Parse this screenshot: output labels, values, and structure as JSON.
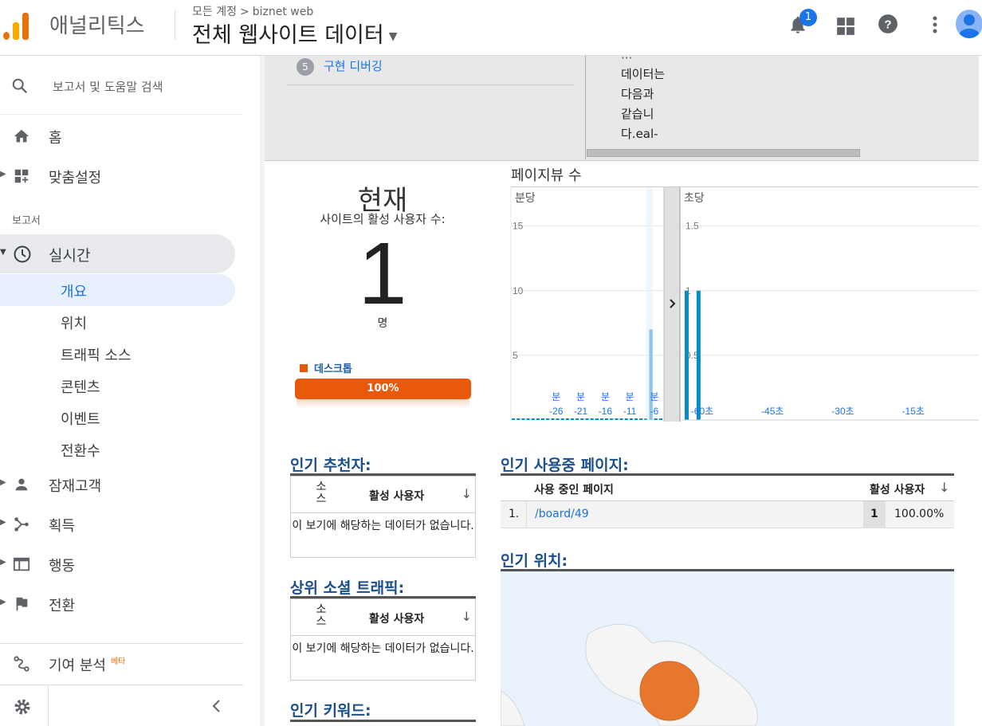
{
  "header": {
    "app_name": "애널리틱스",
    "breadcrumb_account": "모든 계정",
    "breadcrumb_arrow": ">",
    "breadcrumb_property": "biznet web",
    "view_name": "전체 웹사이트 데이터",
    "notification_count": "1"
  },
  "sidebar": {
    "search_label": "보고서 및 도움말 검색",
    "home": "홈",
    "customization": "맞춤설정",
    "reports_section": "보고서",
    "realtime": "실시간",
    "realtime_items": [
      "개요",
      "위치",
      "트래픽 소스",
      "콘텐츠",
      "이벤트",
      "전환수"
    ],
    "audience": "잠재고객",
    "acquisition": "획득",
    "behavior": "행동",
    "conversions": "전환",
    "attribution": "기여 분석",
    "beta": "베타"
  },
  "debug_panel": {
    "step_number": "5",
    "step_label": "구현 디버깅",
    "scroll_text": [
      "데이터는",
      "다음과",
      "같습니",
      "다.eal-"
    ]
  },
  "now": {
    "title": "현재",
    "subtitle": "사이트의 활성 사용자 수:",
    "count": "1",
    "unit": "명",
    "device_label": "데스크톱",
    "device_share": "100%",
    "device_color": "#e8590c"
  },
  "pageviews": {
    "title": "페이지뷰 수",
    "per_minute_label": "분당",
    "per_second_label": "초당",
    "minute_ticks_y": [
      "15",
      "10",
      "5"
    ],
    "second_ticks_y": [
      "1.5",
      "1",
      "0.5"
    ],
    "minute_ticks_x": [
      "-26",
      "-21",
      "-16",
      "-11",
      "-6"
    ],
    "minute_tick_unit": "분",
    "second_ticks_x": [
      "-60초",
      "-45초",
      "-30초",
      "-15초"
    ],
    "expand_icon": "chevron-right-icon",
    "bar_color": "#058dc7"
  },
  "chart_data": [
    {
      "type": "bar",
      "title": "분당",
      "x": [
        -30,
        -29,
        -28,
        -27,
        -26,
        -25,
        -24,
        -23,
        -22,
        -21,
        -20,
        -19,
        -18,
        -17,
        -16,
        -15,
        -14,
        -13,
        -12,
        -11,
        -10,
        -9,
        -8,
        -7,
        -6,
        -5,
        -4,
        -3,
        -2,
        -1,
        0
      ],
      "values": [
        0,
        0,
        0,
        0,
        0,
        0,
        0,
        0,
        0,
        0,
        0,
        0,
        0,
        0,
        0,
        0,
        0,
        0,
        0,
        0,
        0,
        0,
        0,
        0,
        0,
        0,
        0,
        0,
        7,
        0,
        0
      ],
      "ylim": [
        0,
        18
      ]
    },
    {
      "type": "bar",
      "title": "초당",
      "x": [
        -60,
        -59
      ],
      "values": [
        1,
        1
      ],
      "ylim": [
        0,
        1.8
      ]
    }
  ],
  "referrers": {
    "title": "인기 추천자:",
    "col_source": "소스",
    "col_active": "활성 사용자",
    "empty": "이 보기에 해당하는 데이터가 없습니다."
  },
  "social": {
    "title": "상위 소셜 트래픽:",
    "col_source": "소스",
    "col_active": "활성 사용자",
    "empty": "이 보기에 해당하는 데이터가 없습니다."
  },
  "keywords": {
    "title": "인기 키워드:"
  },
  "active_pages": {
    "title": "인기 사용중 페이지:",
    "col_page": "사용 중인 페이지",
    "col_active": "활성 사용자",
    "rows": [
      {
        "rank": "1.",
        "page": "/board/49",
        "users": "1",
        "pct": "100.00%"
      }
    ]
  },
  "locations": {
    "title": "인기 위치:",
    "bubble_color": "#e8772e"
  }
}
